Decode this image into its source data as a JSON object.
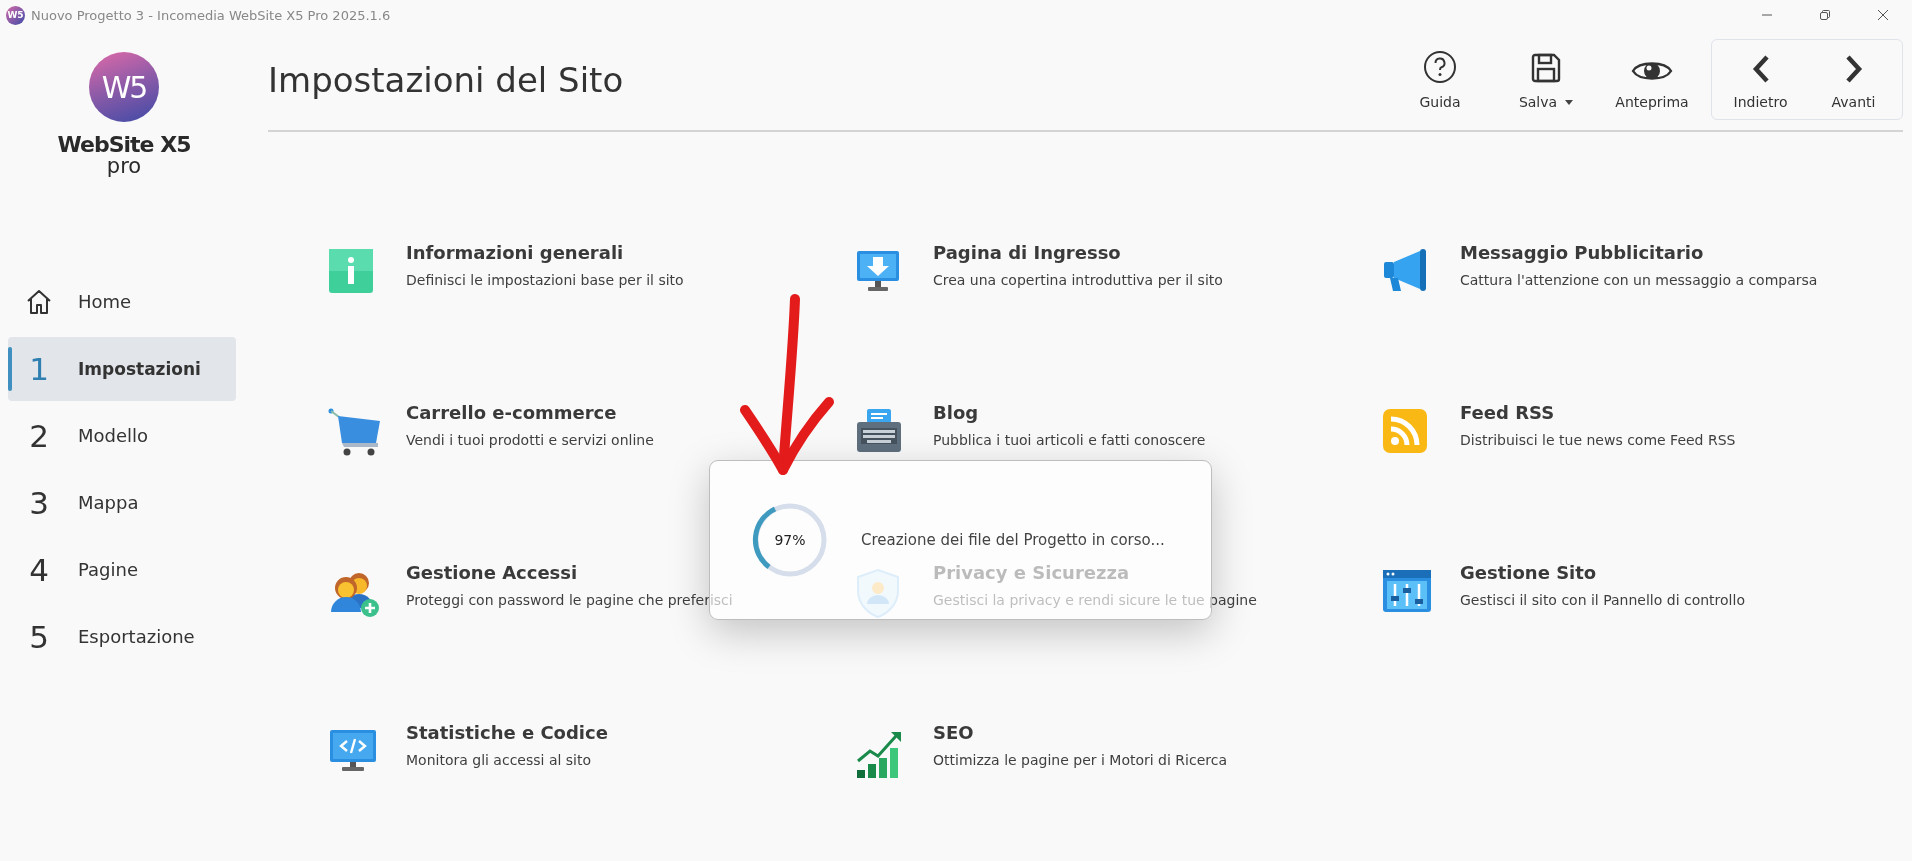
{
  "window": {
    "title": "Nuovo Progetto 3 - Incomedia WebSite X5 Pro 2025.1.6",
    "icon_text": "W5"
  },
  "logo": {
    "mark": "W5",
    "wordmark": "WebSite X5",
    "edition": "pro"
  },
  "header": {
    "title": "Impostazioni del Sito"
  },
  "toolbar": [
    {
      "kind": "help",
      "label": "Guida",
      "has_menu": false
    },
    {
      "kind": "save",
      "label": "Salva",
      "has_menu": true
    },
    {
      "kind": "preview",
      "label": "Anteprima",
      "has_menu": false
    }
  ],
  "navigation": [
    {
      "kind": "back",
      "label": "Indietro"
    },
    {
      "kind": "forward",
      "label": "Avanti"
    }
  ],
  "sidebar": {
    "items": [
      {
        "kind": "home",
        "label": "Home",
        "selected": false
      },
      {
        "kind": "step",
        "number": "1",
        "label": "Impostazioni",
        "selected": true
      },
      {
        "kind": "step",
        "number": "2",
        "label": "Modello",
        "selected": false
      },
      {
        "kind": "step",
        "number": "3",
        "label": "Mappa",
        "selected": false
      },
      {
        "kind": "step",
        "number": "4",
        "label": "Pagine",
        "selected": false
      },
      {
        "kind": "step",
        "number": "5",
        "label": "Esportazione",
        "selected": false
      }
    ]
  },
  "sections": [
    {
      "title": "Informazioni generali",
      "description": "Definisci le impostazioni base per il sito"
    },
    {
      "title": "Pagina di Ingresso",
      "description": "Crea una copertina introduttiva per il sito"
    },
    {
      "title": "Messaggio Pubblicitario",
      "description": "Cattura l'attenzione con un messaggio a comparsa"
    },
    {
      "title": "Carrello e-commerce",
      "description": "Vendi i tuoi prodotti e servizi online"
    },
    {
      "title": "Blog",
      "description": "Pubblica i tuoi articoli e fatti conoscere"
    },
    {
      "title": "Feed RSS",
      "description": "Distribuisci le tue news come Feed RSS"
    },
    {
      "title": "Gestione Accessi",
      "description": "Proteggi con password le pagine che preferisci"
    },
    {
      "title": "Privacy e Sicurezza",
      "description": "Gestisci la privacy e rendi sicure le tue pagine"
    },
    {
      "title": "Gestione Sito",
      "description": "Gestisci il sito con il Pannello di controllo"
    },
    {
      "title": "Statistiche e Codice",
      "description": "Monitora gli accessi al sito"
    },
    {
      "title": "SEO",
      "description": "Ottimizza le pagine per i Motori di Ricerca"
    }
  ],
  "progress_dialog": {
    "percent": "97%",
    "message": "Creazione dei file del Progetto in corso..."
  }
}
